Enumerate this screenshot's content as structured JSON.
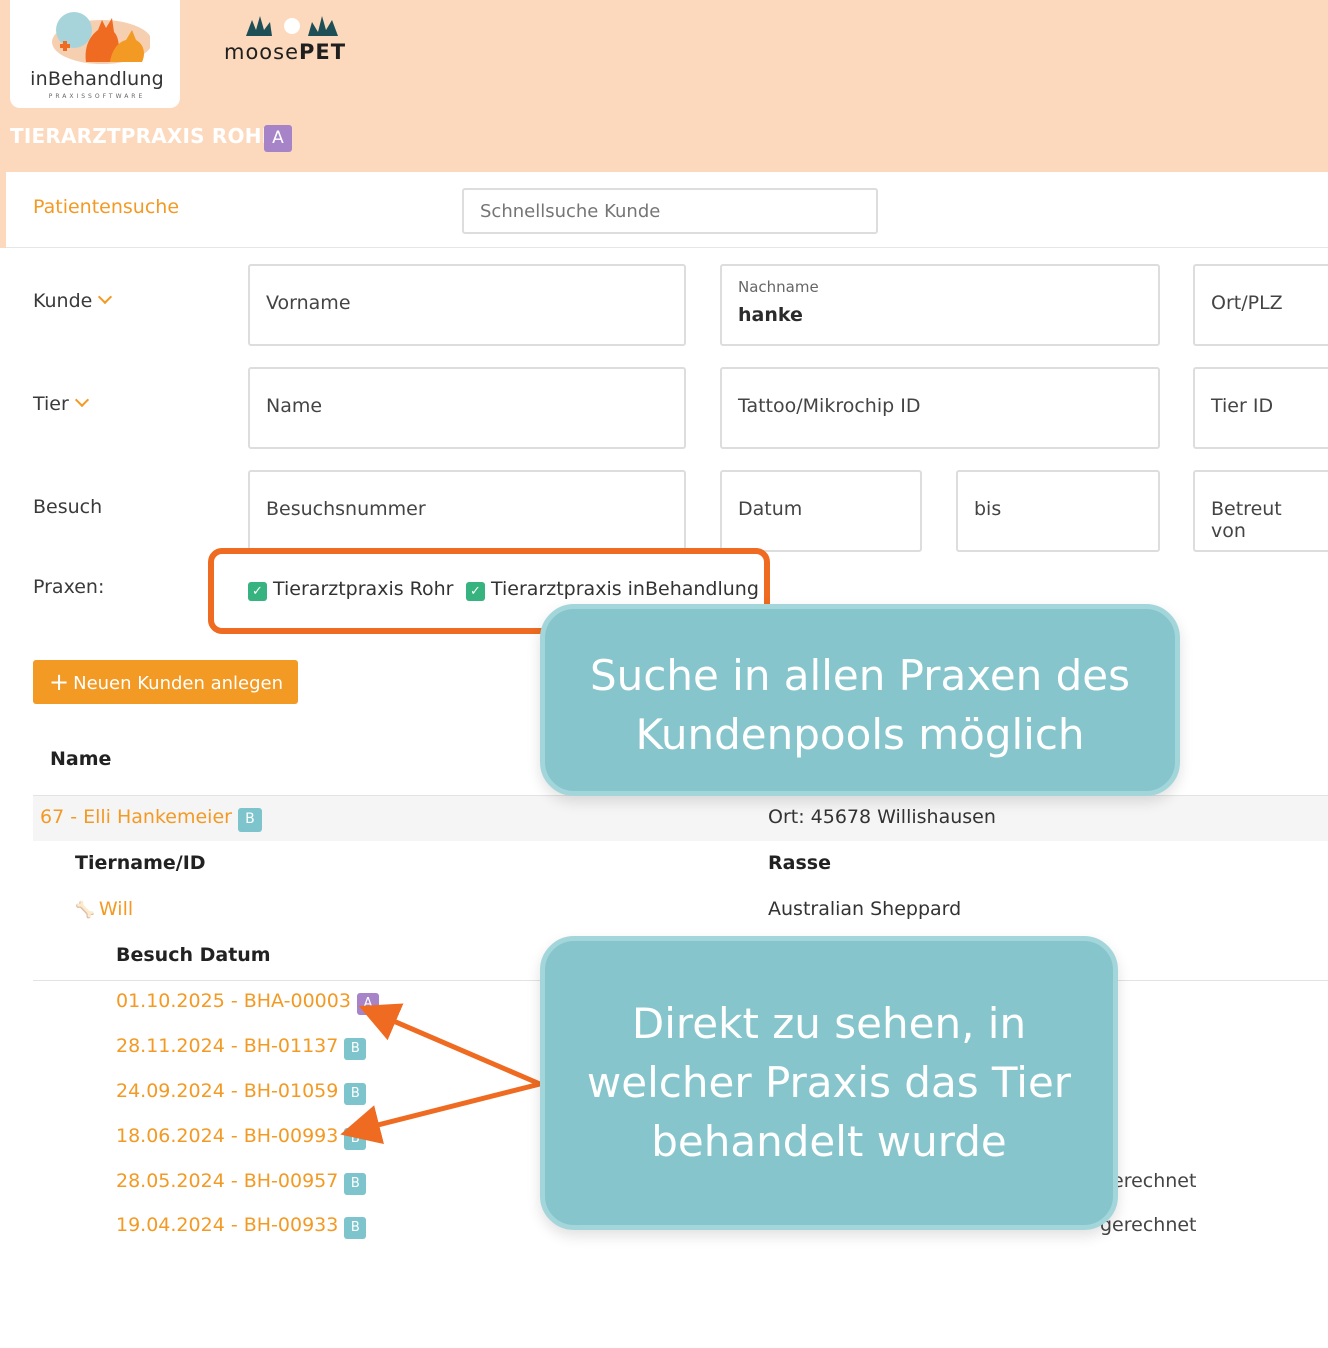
{
  "header": {
    "logo_text": "inBehandlung",
    "logo_subtext": "PRAXISSOFTWARE",
    "partner_logo_light": "moose",
    "partner_logo_bold": "PET",
    "practice_name": "TIERARZTPRAXIS ROHR",
    "practice_badge": "A",
    "colors": {
      "header_bg": "#fcd9bd",
      "accent": "#f39a24",
      "badge_a": "#a783c8",
      "badge_b": "#7dc4cc",
      "callout": "#86c5cc",
      "highlight": "#ee6b21"
    }
  },
  "search": {
    "tab_label": "Patientensuche",
    "quick_search_placeholder": "Schnellsuche Kunde"
  },
  "form": {
    "kunde_label": "Kunde",
    "vorname_placeholder": "Vorname",
    "nachname_label": "Nachname",
    "nachname_value": "hanke",
    "ort_placeholder": "Ort/PLZ",
    "tier_label": "Tier",
    "name_placeholder": "Name",
    "chip_placeholder": "Tattoo/Mikrochip ID",
    "tierid_placeholder": "Tier ID",
    "besuch_label": "Besuch",
    "besuchsnummer_placeholder": "Besuchsnummer",
    "datum_placeholder": "Datum",
    "bis_placeholder": "bis",
    "betreut_placeholder": "Betreut von"
  },
  "praxen": {
    "label": "Praxen:",
    "options": [
      {
        "label": "Tierarztpraxis Rohr",
        "checked": true
      },
      {
        "label": "Tierarztpraxis inBehandlung",
        "checked": true
      }
    ]
  },
  "new_customer_button": "Neuen Kunden anlegen",
  "results": {
    "name_header": "Name",
    "customer": {
      "label": "67 - Elli Hankemeier",
      "badge": "B",
      "ort": "Ort: 45678 Willishausen"
    },
    "animal_header": "Tiername/ID",
    "breed_header": "Rasse",
    "animal": {
      "name": "Will",
      "breed": "Australian Sheppard",
      "icon": "bone-icon"
    },
    "visit_header": "Besuch Datum",
    "visits": [
      {
        "label": "01.10.2025 - BHA-00003",
        "badge": "A"
      },
      {
        "label": "28.11.2024 - BH-01137",
        "badge": "B"
      },
      {
        "label": "24.09.2024 - BH-01059",
        "badge": "B"
      },
      {
        "label": "18.06.2024 - BH-00993",
        "badge": "B"
      },
      {
        "label": "28.05.2024 - BH-00957",
        "badge": "B"
      },
      {
        "label": "19.04.2024 - BH-00933",
        "badge": "B"
      }
    ],
    "status_fragments": [
      "erechnet",
      "gerechnet"
    ]
  },
  "callouts": {
    "top_line1": "Suche in allen Praxen des",
    "top_line2": "Kundenpools möglich",
    "bottom_line1": "Direkt zu sehen, in",
    "bottom_line2": "welcher Praxis das Tier",
    "bottom_line3": "behandelt wurde"
  }
}
